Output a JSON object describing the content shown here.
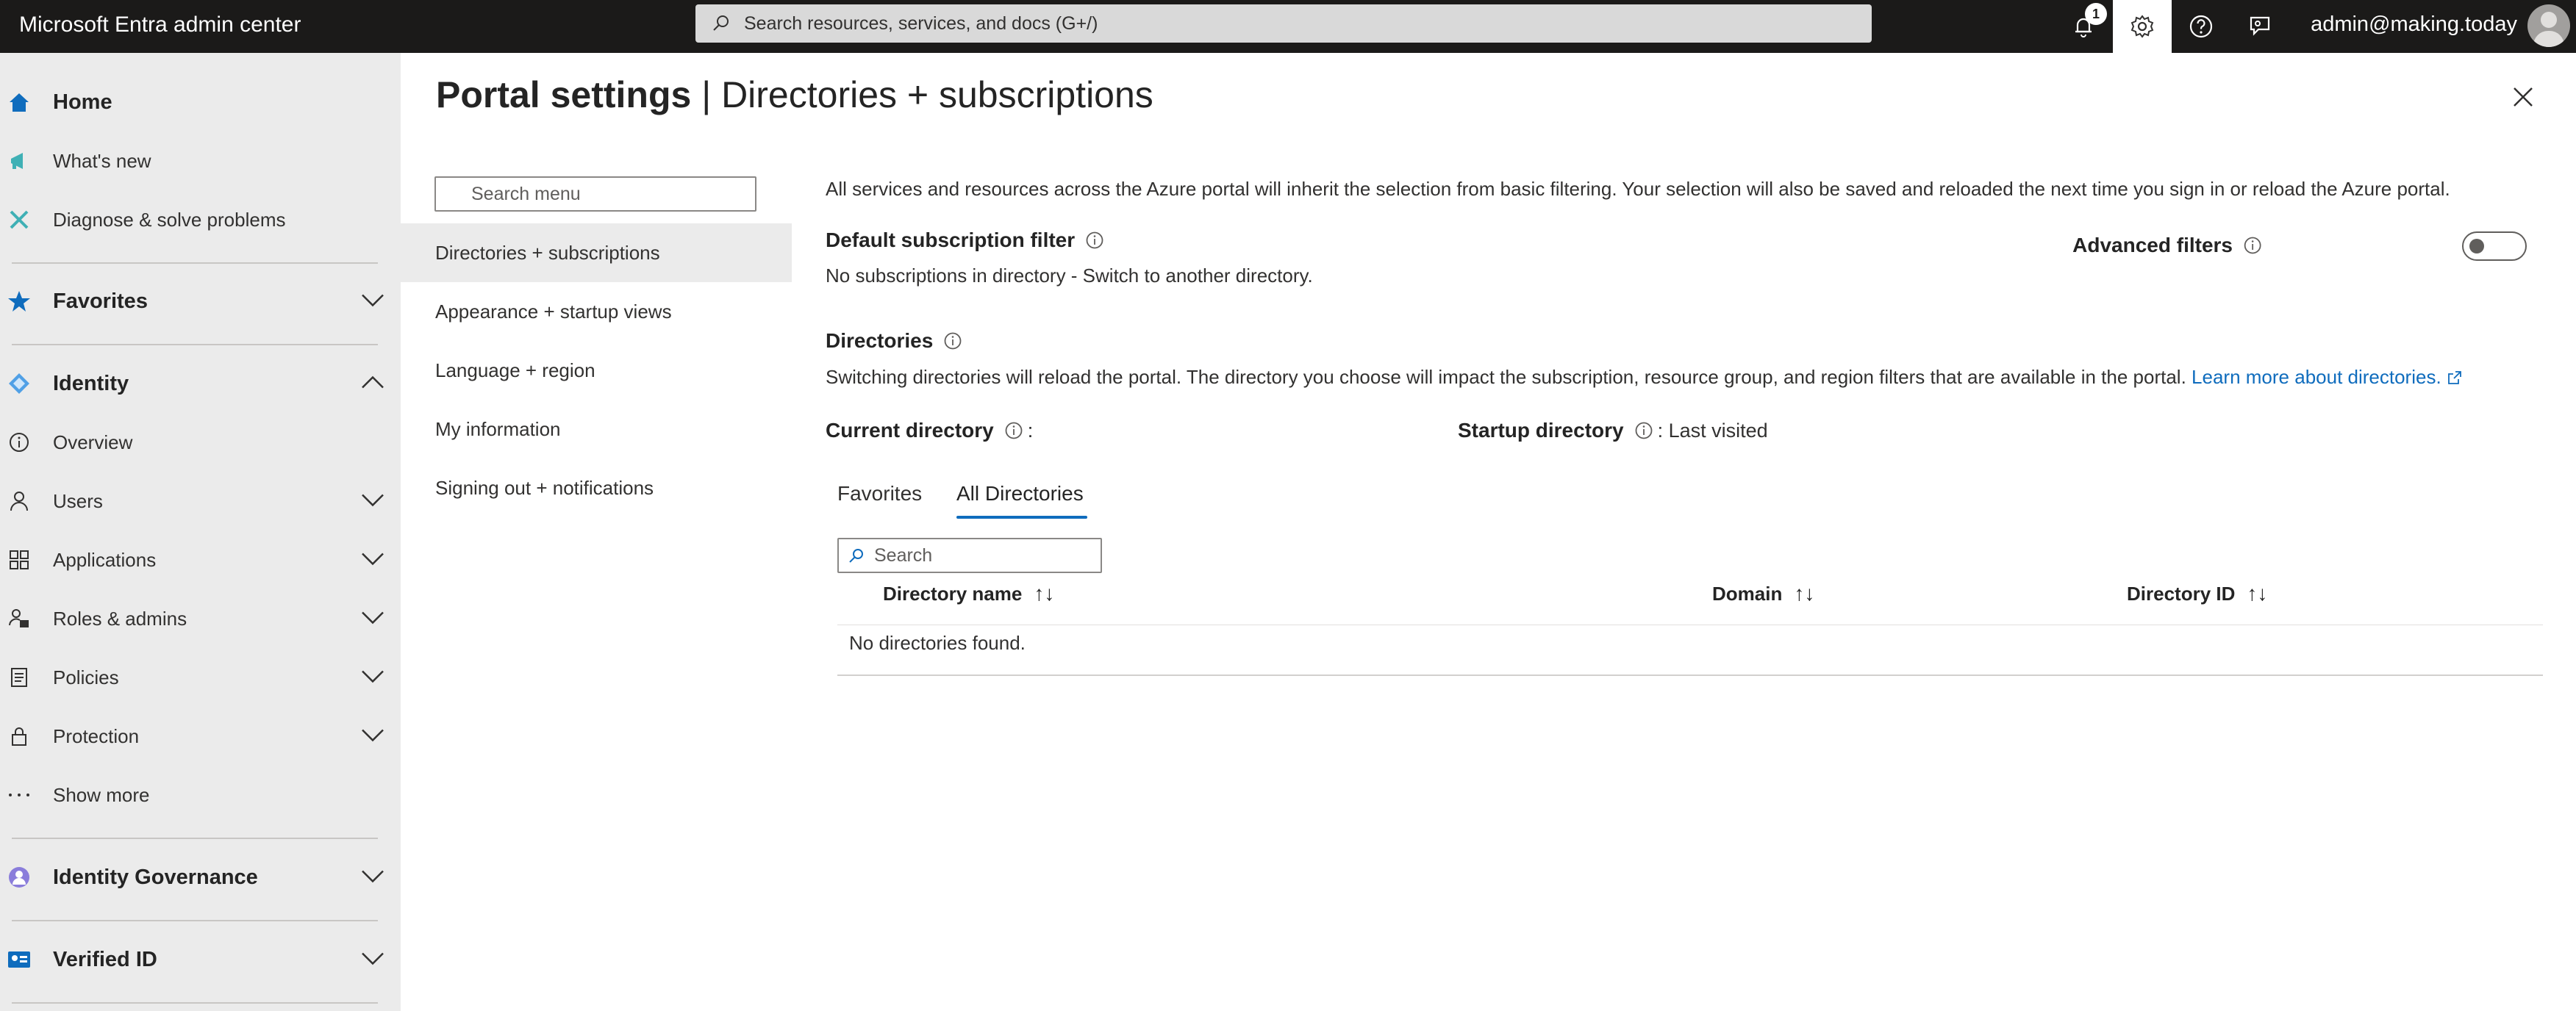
{
  "topbar": {
    "app_title": "Microsoft Entra admin center",
    "search_placeholder": "Search resources, services, and docs (G+/)",
    "notification_count": "1",
    "user": "admin@making.today"
  },
  "leftnav": {
    "items": [
      {
        "label": "Home"
      },
      {
        "label": "What's new"
      },
      {
        "label": "Diagnose & solve problems"
      },
      {
        "label": "Favorites"
      },
      {
        "label": "Identity"
      },
      {
        "label": "Overview"
      },
      {
        "label": "Users"
      },
      {
        "label": "Applications"
      },
      {
        "label": "Roles & admins"
      },
      {
        "label": "Policies"
      },
      {
        "label": "Protection"
      },
      {
        "label": "Show more"
      },
      {
        "label": "Identity Governance"
      },
      {
        "label": "Verified ID"
      }
    ]
  },
  "page": {
    "title_bold": "Portal settings",
    "title_rest": " | Directories + subscriptions"
  },
  "menu": {
    "search_placeholder": "Search menu",
    "items": [
      {
        "label": "Directories + subscriptions"
      },
      {
        "label": "Appearance + startup views"
      },
      {
        "label": "Language + region"
      },
      {
        "label": "My information"
      },
      {
        "label": "Signing out + notifications"
      }
    ]
  },
  "content": {
    "intro": "All services and resources across the Azure portal will inherit the selection from basic filtering. Your selection will also be saved and reloaded the next time you sign in or reload the Azure portal.",
    "default_filter_heading": "Default subscription filter",
    "default_filter_text": "No subscriptions in directory - Switch to another directory.",
    "advanced_filters_label": "Advanced filters",
    "directories_heading": "Directories",
    "directories_text": "Switching directories will reload the portal. The directory you choose will impact the subscription, resource group, and region filters that are available in the portal.",
    "learn_more": "Learn more about directories.",
    "current_directory_label": "Current directory",
    "current_directory_value": ":",
    "startup_directory_label": "Startup directory",
    "startup_directory_value": ": Last visited",
    "tabs": [
      {
        "label": "Favorites"
      },
      {
        "label": "All Directories"
      }
    ],
    "dir_search_placeholder": "Search",
    "columns": [
      {
        "label": "Directory name"
      },
      {
        "label": "Domain"
      },
      {
        "label": "Directory ID"
      }
    ],
    "sort_glyph": "↑↓",
    "empty_text": "No directories found."
  },
  "colors": {
    "accent": "#0f6cbd",
    "topbar": "#1b1a19",
    "nav_bg": "#ebebeb"
  }
}
